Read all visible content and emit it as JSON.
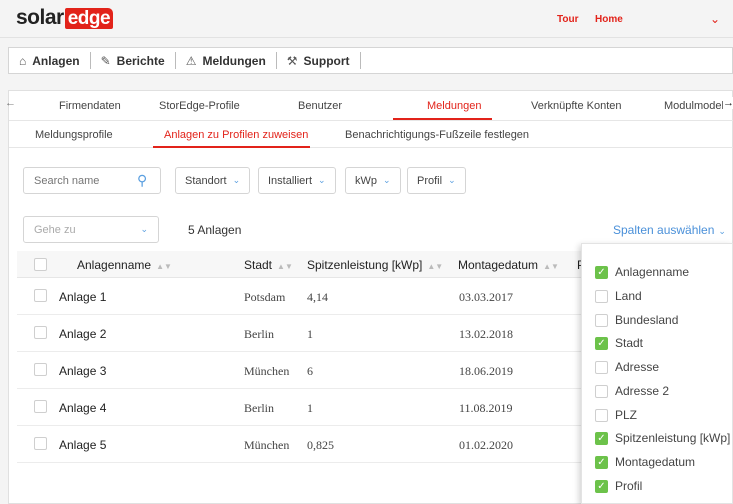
{
  "logo": {
    "solar": "solar",
    "edge": "edge"
  },
  "header": {
    "tour": "Tour",
    "home": "Home"
  },
  "mainnav": [
    {
      "label": "Anlagen",
      "icon": "home-icon"
    },
    {
      "label": "Berichte",
      "icon": "report-icon"
    },
    {
      "label": "Meldungen",
      "icon": "warning-icon"
    },
    {
      "label": "Support",
      "icon": "wrench-icon"
    }
  ],
  "tabs": [
    "Firmendaten",
    "StorEdge-Profile",
    "Benutzer",
    "Meldungen",
    "Verknüpfte Konten",
    "Modulmodelle"
  ],
  "subtabs": [
    "Meldungsprofile",
    "Anlagen zu Profilen zuweisen",
    "Benachrichtigungs-Fußzeile festlegen"
  ],
  "search": {
    "placeholder": "Search name"
  },
  "filters": [
    "Standort",
    "Installiert",
    "kWp",
    "Profil"
  ],
  "goto": {
    "placeholder": "Gehe zu"
  },
  "count_label": "5 Anlagen",
  "columns_button": "Spalten auswählen",
  "table": {
    "headers": {
      "name": "Anlagenname",
      "stadt": "Stadt",
      "spitzen": "Spitzenleistung [kWp]",
      "montage": "Montagedatum",
      "profil": "P"
    },
    "rows": [
      {
        "name": "Anlage 1",
        "stadt": "Potsdam",
        "kwp": "4,14",
        "date": "03.03.2017"
      },
      {
        "name": "Anlage 2",
        "stadt": "Berlin",
        "kwp": "1",
        "date": "13.02.2018"
      },
      {
        "name": "Anlage 3",
        "stadt": "München",
        "kwp": "6",
        "date": "18.06.2019"
      },
      {
        "name": "Anlage 4",
        "stadt": "Berlin",
        "kwp": "1",
        "date": "11.08.2019"
      },
      {
        "name": "Anlage 5",
        "stadt": "München",
        "kwp": "0,825",
        "date": "01.02.2020"
      }
    ]
  },
  "column_options": [
    {
      "label": "Anlagenname",
      "checked": true
    },
    {
      "label": "Land",
      "checked": false
    },
    {
      "label": "Bundesland",
      "checked": false
    },
    {
      "label": "Stadt",
      "checked": true
    },
    {
      "label": "Adresse",
      "checked": false
    },
    {
      "label": "Adresse 2",
      "checked": false
    },
    {
      "label": "PLZ",
      "checked": false
    },
    {
      "label": "Spitzenleistung [kWp]",
      "checked": true
    },
    {
      "label": "Montagedatum",
      "checked": true
    },
    {
      "label": "Profil",
      "checked": true
    }
  ],
  "colors": {
    "brand": "#e2231a",
    "link": "#4a90d9",
    "check": "#6cc24a"
  }
}
